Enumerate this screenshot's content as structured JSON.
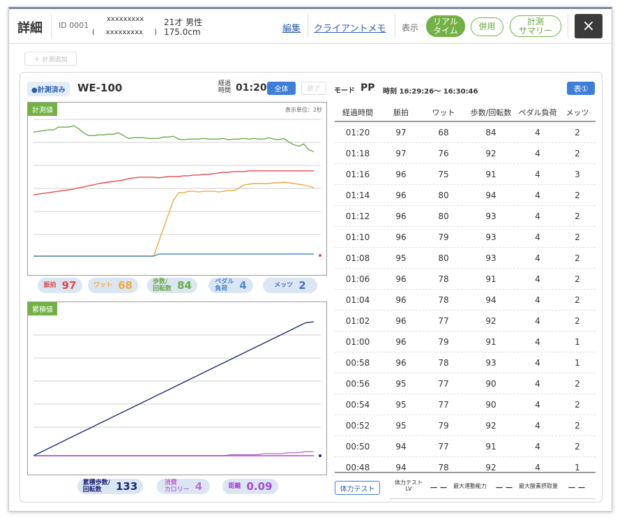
{
  "header": {
    "title": "詳細",
    "client_id": "ID 0001",
    "name_line1": "xxxxxxxxx",
    "name_line2": "(     xxxxxxxxx     )",
    "age_gender": "21才 男性",
    "height": "175.0cm",
    "edit_link": "編集",
    "memo_link": "クライアントメモ",
    "display_label": "表示",
    "realtime_pill": "リアル\nタイム",
    "combined_pill": "併用",
    "summary_pill": "計測\nサマリー",
    "close_icon": "×"
  },
  "toolbar": {
    "add_measure": "計測追加"
  },
  "session": {
    "status": "●計測済み",
    "device": "WE-100",
    "elapsed_label_1": "経過",
    "elapsed_label_2": "時間",
    "elapsed": "01:20",
    "all_button": "全体",
    "end_button": "終了",
    "mode_label": "モード",
    "mode_value": "PP",
    "time_label": "時刻 16:29:26〜 16:30:46",
    "table_button": "表①"
  },
  "colors": {
    "green": "#6aaa4a",
    "red": "#e34848",
    "orange": "#f1a83c",
    "blue": "#4a88d0",
    "navy": "#1e2678",
    "purple": "#a64ad3",
    "pink": "#c26fd0",
    "tag_green": "#73b144"
  },
  "chart_data": [
    {
      "type": "line",
      "title": "計測値",
      "unit_note": "表示単位：2秒",
      "series": [
        {
          "name": "メッツ",
          "color": "#6aaa4a",
          "values": [
            176,
            177,
            178,
            179,
            179,
            183,
            183,
            183,
            185,
            181,
            175,
            171,
            171,
            172,
            172,
            173,
            173,
            175,
            171,
            167,
            168,
            168,
            168,
            167,
            167,
            167,
            169,
            169,
            170,
            166,
            165,
            166,
            166,
            166,
            167,
            166,
            166,
            166,
            167,
            165,
            166,
            166,
            167,
            166,
            167,
            166,
            166,
            168,
            166,
            165,
            167,
            162,
            158,
            156,
            159,
            151,
            148
          ]
        },
        {
          "name": "脈拍",
          "color": "#e34848",
          "values": [
            87,
            88,
            89,
            90,
            91,
            92,
            93,
            94,
            95,
            97,
            98,
            100,
            101,
            103,
            104,
            105,
            106,
            107,
            108,
            110,
            111,
            112,
            112,
            112,
            112,
            111,
            112,
            113,
            113,
            113,
            114,
            114,
            115,
            115,
            116,
            116,
            117,
            118,
            119,
            119,
            120,
            120,
            120,
            121,
            121,
            121,
            121,
            121,
            121,
            121,
            121,
            121,
            121,
            121,
            121,
            121,
            121
          ]
        },
        {
          "name": "ワット",
          "color": "#f1a83c",
          "values": [
            0,
            0,
            0,
            0,
            0,
            0,
            0,
            0,
            0,
            0,
            0,
            0,
            0,
            0,
            0,
            0,
            0,
            0,
            0,
            0,
            0,
            0,
            0,
            0,
            0,
            20,
            40,
            60,
            80,
            90,
            90,
            92,
            92,
            91,
            92,
            92,
            92,
            91,
            92,
            93,
            93,
            96,
            101,
            102,
            103,
            103,
            103,
            103,
            104,
            104,
            105,
            104,
            103,
            102,
            101,
            99,
            97
          ]
        },
        {
          "name": "歩数/回転数",
          "color": "#4a88d0",
          "values": [
            0,
            0,
            0,
            0,
            0,
            0,
            0,
            0,
            0,
            0,
            0,
            0,
            0,
            0,
            0,
            0,
            0,
            0,
            0,
            0,
            0,
            0,
            0,
            0,
            0,
            3,
            3,
            3,
            3,
            3,
            3,
            3,
            3,
            3,
            3,
            3,
            3,
            3,
            3,
            3,
            3,
            3,
            3,
            3,
            3,
            3,
            3,
            3,
            3,
            3,
            3,
            3,
            3,
            3,
            3,
            3,
            3
          ]
        }
      ]
    },
    {
      "type": "line",
      "title": "累積値",
      "series": [
        {
          "name": "累積歩数/回転数",
          "color": "#1e2678",
          "values": [
            0,
            4,
            8,
            12,
            16,
            20,
            24,
            28,
            32,
            36,
            40,
            44,
            48,
            52,
            56,
            60,
            64,
            68,
            72,
            76,
            80,
            84,
            88,
            92,
            96,
            100,
            104,
            108,
            112,
            116,
            120,
            124,
            128,
            132,
            133
          ]
        },
        {
          "name": "消費カロリー",
          "color": "#c26fd0",
          "values": [
            0,
            0,
            0,
            0,
            0,
            0,
            0,
            0,
            0,
            0,
            0,
            0,
            0,
            0,
            0,
            0,
            0,
            0,
            0,
            0,
            0,
            0,
            0,
            0,
            1,
            1,
            1,
            1,
            2,
            2,
            2,
            3,
            3,
            4,
            4
          ]
        },
        {
          "name": "距離",
          "color": "#a64ad3",
          "values": [
            0,
            0,
            0,
            0,
            0,
            0,
            0,
            0,
            0,
            0,
            0,
            0,
            0,
            0,
            0,
            0,
            0,
            0,
            0,
            0,
            0,
            0,
            0,
            0,
            0,
            0,
            0,
            0,
            0,
            0,
            0,
            0,
            0,
            0,
            0
          ]
        }
      ]
    }
  ],
  "chips_top": [
    {
      "label": "脈拍",
      "value": "97",
      "color": "#e34848"
    },
    {
      "label": "ワット",
      "value": "68",
      "color": "#f1a83c"
    },
    {
      "label": "歩数/\n回転数",
      "value": "84",
      "color": "#6aaa4a"
    },
    {
      "label": "ペダル\n負荷",
      "value": "4",
      "color": "#4a88d0"
    },
    {
      "label": "メッツ",
      "value": "2",
      "color": "#4a6fc0"
    }
  ],
  "chips_bottom": [
    {
      "label": "累積歩数/\n回転数",
      "value": "133",
      "color": "#1e2678"
    },
    {
      "label": "消費\nカロリー",
      "value": "4",
      "color": "#c26fd0"
    },
    {
      "label": "距離",
      "value": "0.09",
      "color": "#a64ad3"
    }
  ],
  "table": {
    "headers": [
      "経過時間",
      "脈拍",
      "ワット",
      "歩数/回転数",
      "ペダル負荷",
      "メッツ"
    ],
    "rows": [
      [
        "01:20",
        "97",
        "68",
        "84",
        "4",
        "2"
      ],
      [
        "01:18",
        "97",
        "76",
        "92",
        "4",
        "2"
      ],
      [
        "01:16",
        "96",
        "75",
        "91",
        "4",
        "3"
      ],
      [
        "01:14",
        "96",
        "80",
        "94",
        "4",
        "2"
      ],
      [
        "01:12",
        "96",
        "80",
        "93",
        "4",
        "2"
      ],
      [
        "01:10",
        "96",
        "79",
        "93",
        "4",
        "2"
      ],
      [
        "01:08",
        "95",
        "80",
        "93",
        "4",
        "2"
      ],
      [
        "01:06",
        "96",
        "78",
        "91",
        "4",
        "2"
      ],
      [
        "01:04",
        "96",
        "78",
        "94",
        "4",
        "2"
      ],
      [
        "01:02",
        "96",
        "77",
        "92",
        "4",
        "2"
      ],
      [
        "01:00",
        "96",
        "79",
        "91",
        "4",
        "1"
      ],
      [
        "00:58",
        "96",
        "78",
        "93",
        "4",
        "1"
      ],
      [
        "00:56",
        "95",
        "77",
        "90",
        "4",
        "2"
      ],
      [
        "00:54",
        "95",
        "77",
        "90",
        "4",
        "2"
      ],
      [
        "00:52",
        "95",
        "79",
        "92",
        "4",
        "2"
      ],
      [
        "00:50",
        "94",
        "77",
        "91",
        "4",
        "2"
      ],
      [
        "00:48",
        "94",
        "78",
        "92",
        "4",
        "1"
      ]
    ]
  },
  "fitness": {
    "test_button": "体力テスト",
    "lv_label": "体力テスト\nLV",
    "lv_value": "－－",
    "max_motor_label": "最大運動能力",
    "max_motor_value": "－－",
    "vo2_label": "最大酸素摂取量",
    "vo2_value": "－－"
  }
}
